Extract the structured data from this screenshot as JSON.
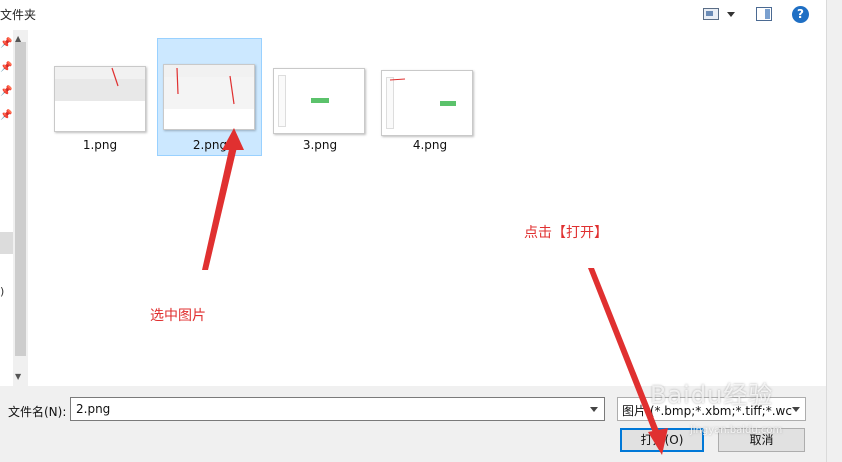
{
  "toolbar": {
    "title": "文件夹",
    "help_label": "?"
  },
  "nav": {
    "paren": ")"
  },
  "files": [
    {
      "name": "1.png",
      "selected": false
    },
    {
      "name": "2.png",
      "selected": true
    },
    {
      "name": "3.png",
      "selected": false
    },
    {
      "name": "4.png",
      "selected": false
    }
  ],
  "annotations": {
    "select_image": "选中图片",
    "click_open": "点击【打开】"
  },
  "bottom": {
    "filename_label": "文件名(N):",
    "filename_value": "2.png",
    "filetype_value": "图片 (*.bmp;*.xbm;*.tiff;*.wc",
    "open_label": "打开(O)",
    "cancel_label": "取消"
  },
  "watermark": {
    "text": "Baidu经验",
    "url": "jingyan.baidu.com"
  },
  "colors": {
    "selection_bg": "#cce8ff",
    "selection_border": "#99d1ff",
    "annotation_red": "#e03030",
    "accent_blue": "#0078d7"
  }
}
